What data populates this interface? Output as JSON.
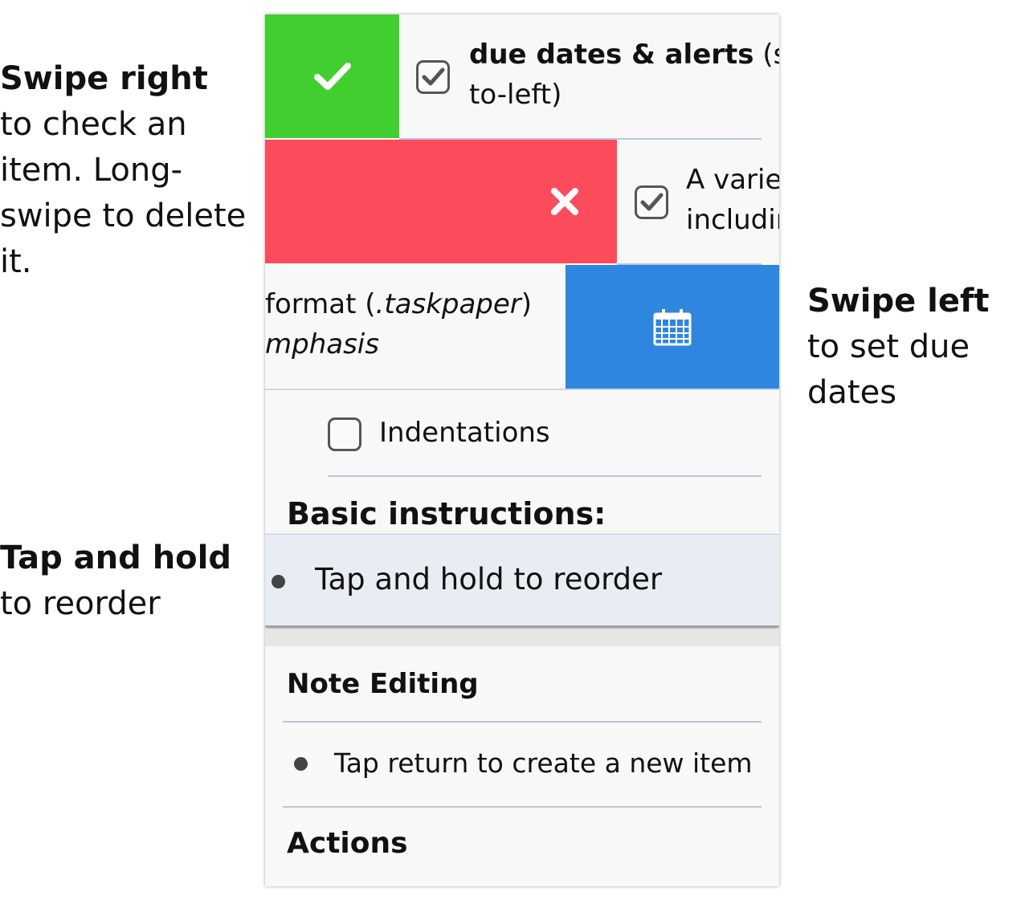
{
  "callouts": {
    "swipe_right_bold": "Swipe right",
    "swipe_right_rest": " to check an item. Long-swipe to delete it.",
    "swipe_left_bold": "Swipe left",
    "swipe_left_rest": " to set due dates",
    "tap_hold_bold": "Tap and hold",
    "tap_hold_rest": " to reorder"
  },
  "rows": {
    "due_dates_bold": "due dates & alerts",
    "due_dates_rest": " (swipe",
    "due_dates_line2": "to-left)",
    "variety_line1": "A variety",
    "variety_line2": "including",
    "format_pre": "format (",
    "format_italic": ".taskpaper",
    "format_post": ")",
    "emphasis_italic": "mphasis",
    "indentations": "Indentations"
  },
  "sections": {
    "basic_instructions": "Basic instructions:",
    "tap_hold_item": "Tap and hold to reorder",
    "note_editing": "Note Editing",
    "tap_return_item": "Tap return to create a new item",
    "actions": "Actions"
  },
  "colors": {
    "check_swipe": "#41cf2f",
    "delete_swipe": "#fc4c5c",
    "due_date_swipe": "#2f86de",
    "drag_row": "#e8edf4"
  },
  "icons": [
    "checkmark-icon",
    "delete-x-icon",
    "calendar-icon",
    "checkbox-checked-icon",
    "checkbox-empty-icon",
    "bullet-icon"
  ]
}
